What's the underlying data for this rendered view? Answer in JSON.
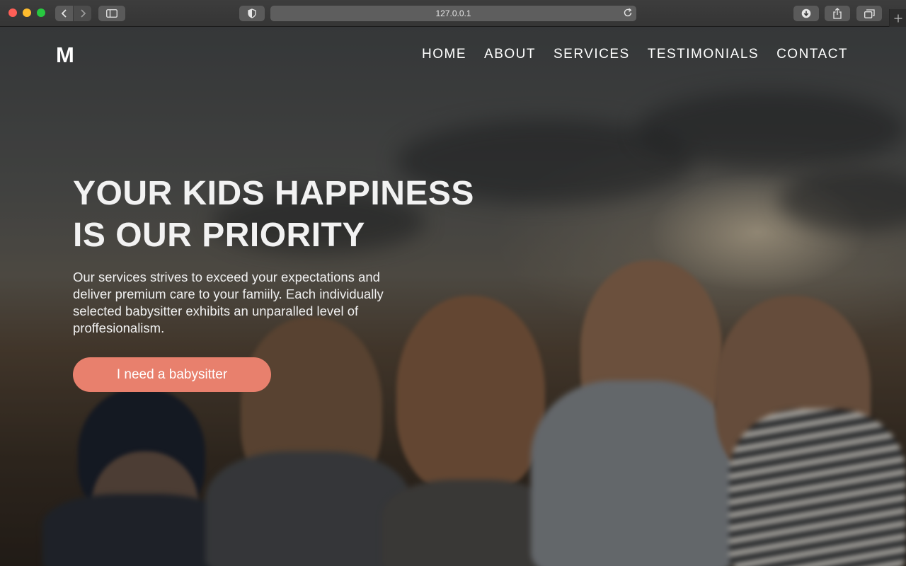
{
  "browser": {
    "url": "127.0.0.1"
  },
  "site": {
    "logo": "M",
    "nav": [
      "HOME",
      "ABOUT",
      "SERVICES",
      "TESTIMONIALS",
      "CONTACT"
    ]
  },
  "hero": {
    "headline_line1": "YOUR KIDS HAPPINESS",
    "headline_line2": "IS OUR PRIORITY",
    "lead": "Our services strives to exceed your expectations and deliver premium care to your famiily. Each individually selected babysitter exhibits an unparalled level of proffesionalism.",
    "cta_label": "I need a babysitter"
  },
  "colors": {
    "accent": "#e8806d",
    "chrome": "#3a3a3a"
  }
}
